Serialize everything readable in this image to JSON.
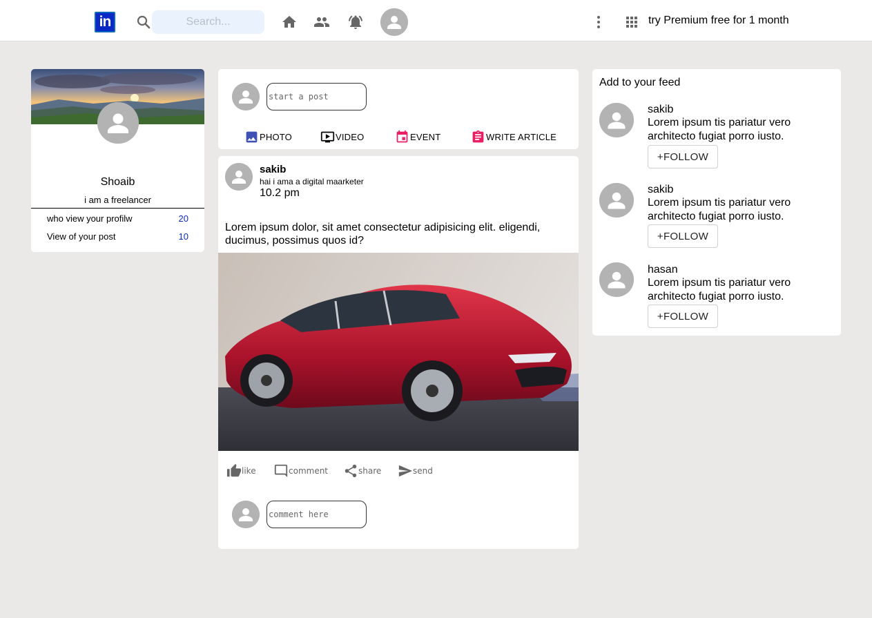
{
  "topbar": {
    "logo_text": "in",
    "search_placeholder": "Search...",
    "premium_text": "try Premium free for 1 month",
    "icons": [
      "search-icon",
      "home-icon",
      "people-icon",
      "notifications-icon",
      "avatar",
      "more-vert-icon",
      "apps-grid-icon"
    ]
  },
  "profile": {
    "name": "Shoaib",
    "headline": "i am a freelancer",
    "stats": [
      {
        "label": "who view your profilw",
        "value": "20"
      },
      {
        "label": "View of your post",
        "value": "10"
      }
    ]
  },
  "composer": {
    "placeholder": "start a post",
    "actions": [
      {
        "label": "PHOTO",
        "icon": "photo-icon",
        "color": "#3f51b5"
      },
      {
        "label": "VIDEO",
        "icon": "video-icon",
        "color": "#000000"
      },
      {
        "label": "EVENT",
        "icon": "event-icon",
        "color": "#e91e63"
      },
      {
        "label": "WRITE ARTICLE",
        "icon": "article-icon",
        "color": "#e91e63"
      }
    ]
  },
  "post": {
    "author": "sakib",
    "headline": "hai i ama a digital maarketer",
    "time": "10.2 pm",
    "text": "Lorem ipsum dolor, sit amet consectetur adipisicing elit. eligendi, ducimus, possimus quos id?",
    "reactions": [
      {
        "label": "like",
        "icon": "thumb-up-icon"
      },
      {
        "label": "comment",
        "icon": "comment-icon"
      },
      {
        "label": "share",
        "icon": "share-icon"
      },
      {
        "label": "send",
        "icon": "send-icon"
      }
    ],
    "comment_placeholder": "comment here"
  },
  "feed": {
    "title": "Add to your feed",
    "items": [
      {
        "name": "sakib",
        "desc": "Lorem ipsum tis pariatur vero architecto fugiat porro iusto.",
        "button": "+FOLLOW"
      },
      {
        "name": "sakib",
        "desc": "Lorem ipsum tis pariatur vero architecto fugiat porro iusto.",
        "button": "+FOLLOW"
      },
      {
        "name": "hasan",
        "desc": "Lorem ipsum tis pariatur vero architecto fugiat porro iusto.",
        "button": "+FOLLOW"
      }
    ]
  },
  "colors": {
    "brand": "#0a66c2",
    "stat_value": "#0a28c4",
    "page_bg": "#ebe9e7",
    "icon_gray": "#666666"
  }
}
